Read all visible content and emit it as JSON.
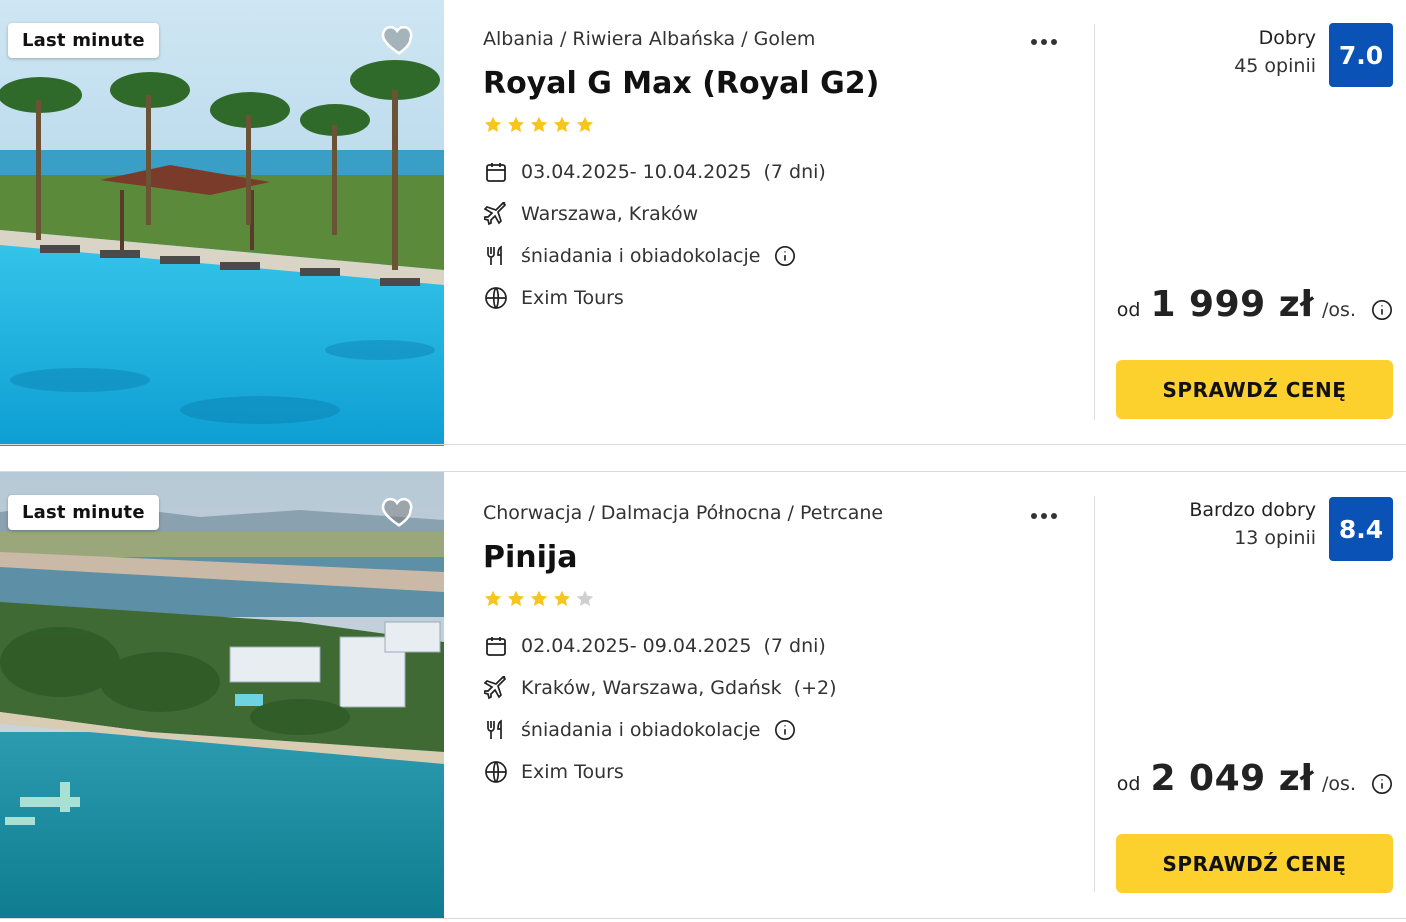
{
  "colors": {
    "score_bg": "#0a52b6",
    "cta_bg": "#fcd12d",
    "star_on": "#f8c51c",
    "star_off": "#cfcfcf"
  },
  "icons": {
    "favorite": "heart-icon",
    "more": "more-dots-icon",
    "date": "calendar-icon",
    "departure": "plane-icon",
    "meals": "cutlery-icon",
    "operator": "globe-icon",
    "info": "info-icon",
    "star": "star-icon"
  },
  "offers": [
    {
      "badge": "Last minute",
      "breadcrumb": "Albania / Riwiera Albańska / Golem",
      "hotel_name": "Royal G Max (Royal G2)",
      "stars": 5,
      "stars_max": 5,
      "dates": "03.04.2025- 10.04.2025",
      "duration": "(7 dni)",
      "departure": "Warszawa, Kraków",
      "departure_extra": "",
      "meals": "śniadania i obiadokolacje",
      "operator": "Exim Tours",
      "rating_label": "Dobry",
      "reviews": "45 opinii",
      "score": "7.0",
      "price_prefix": "od",
      "price": "1 999 zł",
      "price_unit": "/os.",
      "cta": "SPRAWDŹ CENĘ"
    },
    {
      "badge": "Last minute",
      "breadcrumb": "Chorwacja / Dalmacja Północna / Petrcane",
      "hotel_name": "Pinija",
      "stars": 4,
      "stars_max": 5,
      "dates": "02.04.2025- 09.04.2025",
      "duration": "(7 dni)",
      "departure": "Kraków, Warszawa, Gdańsk",
      "departure_extra": "(+2)",
      "meals": "śniadania i obiadokolacje",
      "operator": "Exim Tours",
      "rating_label": "Bardzo dobry",
      "reviews": "13 opinii",
      "score": "8.4",
      "price_prefix": "od",
      "price": "2 049 zł",
      "price_unit": "/os.",
      "cta": "SPRAWDŹ CENĘ"
    }
  ]
}
